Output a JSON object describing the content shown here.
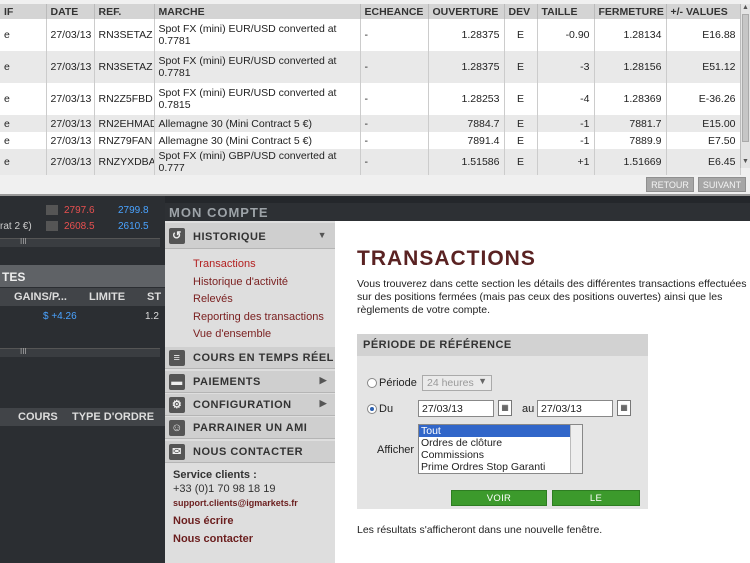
{
  "table": {
    "headers": [
      "IF",
      "DATE",
      "REF.",
      "MARCHE",
      "ECHEANCE",
      "OUVERTURE",
      "DEV",
      "TAILLE",
      "FERMETURE",
      "+/- VALUES"
    ],
    "rows": [
      {
        "c0": "e",
        "date": "27/03/13",
        "ref": "RN3SETAZ",
        "marche": "Spot FX (mini) EUR/USD converted at 0.7781",
        "echeance": "-",
        "ouverture": "1.28375",
        "dev": "E",
        "taille": "-0.90",
        "fermeture": "1.28134",
        "values": "E16.88"
      },
      {
        "c0": "e",
        "date": "27/03/13",
        "ref": "RN3SETAZ",
        "marche": "Spot FX (mini) EUR/USD converted at 0.7781",
        "echeance": "-",
        "ouverture": "1.28375",
        "dev": "E",
        "taille": "-3",
        "fermeture": "1.28156",
        "values": "E51.12"
      },
      {
        "c0": "e",
        "date": "27/03/13",
        "ref": "RN2Z5FBD",
        "marche": "Spot FX (mini) EUR/USD converted at 0.7815",
        "echeance": "-",
        "ouverture": "1.28253",
        "dev": "E",
        "taille": "-4",
        "fermeture": "1.28369",
        "values": "E-36.26"
      },
      {
        "c0": "e",
        "date": "27/03/13",
        "ref": "RN2EHMAD",
        "marche": "Allemagne 30 (Mini Contract 5 €)",
        "echeance": "-",
        "ouverture": "7884.7",
        "dev": "E",
        "taille": "-1",
        "fermeture": "7881.7",
        "values": "E15.00"
      },
      {
        "c0": "e",
        "date": "27/03/13",
        "ref": "RNZ79FAN",
        "marche": "Allemagne 30 (Mini Contract 5 €)",
        "echeance": "-",
        "ouverture": "7891.4",
        "dev": "E",
        "taille": "-1",
        "fermeture": "7889.9",
        "values": "E7.50"
      },
      {
        "c0": "e",
        "date": "27/03/13",
        "ref": "RNZYXDBA",
        "marche": "Spot FX (mini) GBP/USD converted at 0.777",
        "echeance": "-",
        "ouverture": "1.51586",
        "dev": "E",
        "taille": "+1",
        "fermeture": "1.51669",
        "values": "E6.45"
      }
    ],
    "retour": "RETOUR",
    "suivant": "SUIVANT"
  },
  "background": {
    "row1": {
      "v1": "2797.6",
      "v2": "2799.8"
    },
    "row2": {
      "label": "rat 2 €)",
      "v1": "2608.5",
      "v2": "2610.5"
    },
    "pane1_title": "TES",
    "pane1_cols": [
      "GAINS/P...",
      "LIMITE",
      "ST"
    ],
    "pane1_cell": "$ +4.26",
    "pane1_cell2": "1.2",
    "pane2_cols": [
      "COURS",
      "TYPE D'ORDRE"
    ],
    "scroll_mark": "III"
  },
  "account": {
    "title": "MON COMPTE",
    "menu": {
      "historique": "HISTORIQUE",
      "subs": [
        "Transactions",
        "Historique d'activité",
        "Relevés",
        "Reporting des transactions",
        "Vue d'ensemble"
      ],
      "temps_reel": "COURS EN TEMPS RÉEL",
      "paiements": "PAIEMENTS",
      "configuration": "CONFIGURATION",
      "parrainer": "PARRAINER UN AMI",
      "contact": "NOUS CONTACTER"
    },
    "contact": {
      "service": "Service clients :",
      "phone": "+33 (0)1 70 98 18 19",
      "email": "support.clients@igmarkets.fr",
      "ecrire": "Nous écrire",
      "contacter": "Nous contacter"
    }
  },
  "main": {
    "title": "TRANSACTIONS",
    "intro": "Vous trouverez dans cette section les détails des différentes transactions effectuées sur des positions fermées (mais pas ceux des positions ouvertes) ainsi que les règlements de votre compte.",
    "box_title": "PÉRIODE DE RÉFÉRENCE",
    "periode_label": "Période",
    "periode_value": "24 heures",
    "du_label": "Du",
    "du_value": "27/03/13",
    "au_label": "au",
    "au_value": "27/03/13",
    "afficher_label": "Afficher",
    "afficher_options": [
      "Tout",
      "Ordres de clôture",
      "Commissions",
      "Prime Ordres Stop Garanti"
    ],
    "btn_historique": "VOIR L'HISTORIQUE",
    "btn_telecharger": "LE TÉLÉCHARGER",
    "note": "Les résultats s'afficheront dans une nouvelle fenêtre."
  }
}
